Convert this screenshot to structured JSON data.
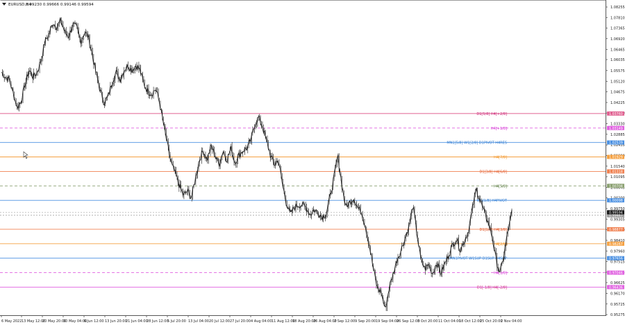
{
  "header": {
    "symbol_label": "EURUSD,H4",
    "ohlc_label": "0.99230 0.99666 0.99146 0.99594",
    "menu_icon": "triangle-down-icon"
  },
  "price_axis": {
    "ticks": [
      "1.08255",
      "1.07810",
      "1.07365",
      "1.06920",
      "1.06465",
      "1.06035",
      "1.05575",
      "1.05120",
      "1.04675",
      "1.04225",
      "1.03780",
      "1.03330",
      "1.02885",
      "1.02435",
      "1.01990",
      "1.01540",
      "1.01095",
      "1.00645",
      "1.00200",
      "0.99750",
      "0.99305",
      "0.98860",
      "0.98410",
      "0.97960",
      "0.97515",
      "0.97065",
      "0.96625",
      "0.96170",
      "0.95725",
      "0.95275"
    ],
    "range": [
      0.9525,
      1.0855
    ]
  },
  "time_axis": {
    "labels": [
      "6 May 2022",
      "13 May 12:00",
      "20 May 20:00",
      "30 May 04:00",
      "6 Jun 12:00",
      "13 Jun 20:00",
      "21 Jun 04:00",
      "28 Jun 12:00",
      "5 Jul 20:00",
      "13 Jul 04:00",
      "20 Jul 12:00",
      "27 Jul 20:00",
      "4 Aug 04:00",
      "11 Aug 12:00",
      "18 Aug 20:00",
      "26 Aug 04:00",
      "2 Sep 12:00",
      "9 Sep 20:00",
      "19 Sep 04:00",
      "26 Sep 12:00",
      "3 Oct 20:00",
      "11 Oct 04:00",
      "18 Oct 12:00",
      "25 Oct 20:00",
      "2 Nov 04:00"
    ]
  },
  "levels": [
    {
      "price": 1.0376,
      "label": "D1[5/8] H4[+2/8]",
      "tag": "1.03760",
      "color": "#e06090",
      "style": "solid",
      "label_color": "#c8166e"
    },
    {
      "price": 1.03149,
      "label": "H4[+1/8]",
      "tag": "1.03149",
      "color": "#e060e0",
      "style": "dash",
      "label_color": "#d020d0"
    },
    {
      "price": 1.02539,
      "label": "MN1[5/8] W1[2/8] D1PIVOT H4RES",
      "tag": "1.02539",
      "color": "#4a90e2",
      "style": "solid",
      "label_color": "#2a78d0"
    },
    {
      "price": 1.01929,
      "label": "H4[7/8]",
      "tag": "1.01929",
      "color": "#f5a040",
      "style": "solid",
      "label_color": "#f08a10"
    },
    {
      "price": 1.01318,
      "label": "D1[3/8] H4[6/8]",
      "tag": "1.01318",
      "color": "#f08050",
      "style": "solid",
      "label_color": "#e05020"
    },
    {
      "price": 1.00708,
      "label": "H4[5/8]",
      "tag": "1.00708",
      "color": "#8aa070",
      "style": "dash",
      "label_color": "#4a7030"
    },
    {
      "price": 1.00098,
      "label": "W1[1/8] H4PIVOT",
      "tag": "1.00098",
      "color": "#4a90e2",
      "style": "solid",
      "label_color": "#2a78d0"
    },
    {
      "price": 0.98877,
      "label": "D1[1/8] H4[3/8]",
      "tag": "0.98877",
      "color": "#f08050",
      "style": "solid",
      "label_color": "#e05020"
    },
    {
      "price": 0.98267,
      "label": "H4[2/8]",
      "tag": "0.98267",
      "color": "#f5a040",
      "style": "solid",
      "label_color": "#f08a10"
    },
    {
      "price": 0.97656,
      "label": "MN1PIVOT W1SUP D1SUP H4SUP",
      "tag": "0.97656",
      "color": "#4a90e2",
      "style": "solid",
      "label_color": "#2a78d0"
    },
    {
      "price": 0.97046,
      "label": "H4[1/8]",
      "tag": "0.97046",
      "color": "#e060e0",
      "style": "dash",
      "label_color": "#d020d0"
    },
    {
      "price": 0.96436,
      "label": "D1[-1/8] H4[-2/8]",
      "tag": "0.96436",
      "color": "#e060e0",
      "style": "solid",
      "label_color": "#c8166e"
    }
  ],
  "current_price": {
    "price": 0.99594,
    "tag": "0.99594"
  },
  "secondary_price": {
    "price": 0.99467,
    "tag": "0.99467"
  },
  "chart_data": {
    "type": "candlestick-line",
    "symbol": "EURUSD",
    "timeframe": "H4",
    "ylim": [
      0.9525,
      1.0855
    ],
    "waypoints": [
      [
        0,
        1.055
      ],
      [
        2,
        1.053
      ],
      [
        4,
        1.052
      ],
      [
        6,
        1.046
      ],
      [
        8,
        1.04
      ],
      [
        10,
        1.043
      ],
      [
        12,
        1.05
      ],
      [
        14,
        1.056
      ],
      [
        16,
        1.053
      ],
      [
        18,
        1.055
      ],
      [
        20,
        1.06
      ],
      [
        22,
        1.068
      ],
      [
        24,
        1.071
      ],
      [
        26,
        1.076
      ],
      [
        28,
        1.074
      ],
      [
        30,
        1.077
      ],
      [
        32,
        1.072
      ],
      [
        34,
        1.07
      ],
      [
        36,
        1.075
      ],
      [
        38,
        1.074
      ],
      [
        40,
        1.068
      ],
      [
        42,
        1.072
      ],
      [
        44,
        1.07
      ],
      [
        46,
        1.062
      ],
      [
        48,
        1.054
      ],
      [
        50,
        1.047
      ],
      [
        52,
        1.042
      ],
      [
        54,
        1.045
      ],
      [
        56,
        1.051
      ],
      [
        58,
        1.055
      ],
      [
        60,
        1.052
      ],
      [
        62,
        1.056
      ],
      [
        64,
        1.058
      ],
      [
        66,
        1.056
      ],
      [
        68,
        1.058
      ],
      [
        70,
        1.056
      ],
      [
        72,
        1.05
      ],
      [
        74,
        1.047
      ],
      [
        76,
        1.046
      ],
      [
        78,
        1.048
      ],
      [
        80,
        1.042
      ],
      [
        82,
        1.033
      ],
      [
        84,
        1.024
      ],
      [
        86,
        1.016
      ],
      [
        88,
        1.012
      ],
      [
        90,
        1.007
      ],
      [
        92,
        1.003
      ],
      [
        94,
        1.005
      ],
      [
        96,
        1.002
      ],
      [
        98,
        1.01
      ],
      [
        100,
        1.018
      ],
      [
        102,
        1.022
      ],
      [
        104,
        1.018
      ],
      [
        106,
        1.024
      ],
      [
        108,
        1.02
      ],
      [
        110,
        1.016
      ],
      [
        112,
        1.022
      ],
      [
        114,
        1.018
      ],
      [
        116,
        1.023
      ],
      [
        118,
        1.017
      ],
      [
        120,
        1.02
      ],
      [
        122,
        1.022
      ],
      [
        124,
        1.023
      ],
      [
        126,
        1.026
      ],
      [
        128,
        1.033
      ],
      [
        130,
        1.036
      ],
      [
        132,
        1.032
      ],
      [
        134,
        1.026
      ],
      [
        136,
        1.02
      ],
      [
        138,
        1.016
      ],
      [
        140,
        1.018
      ],
      [
        142,
        1.008
      ],
      [
        144,
        1.0
      ],
      [
        146,
        0.995
      ],
      [
        148,
        0.998
      ],
      [
        150,
        0.999
      ],
      [
        152,
        0.999
      ],
      [
        154,
        0.998
      ],
      [
        156,
        0.995
      ],
      [
        158,
        0.997
      ],
      [
        160,
        0.996
      ],
      [
        162,
        0.994
      ],
      [
        164,
        0.995
      ],
      [
        166,
        1.002
      ],
      [
        168,
        1.01
      ],
      [
        170,
        1.02
      ],
      [
        172,
        1.008
      ],
      [
        174,
        0.998
      ],
      [
        176,
        1.0
      ],
      [
        178,
        1.002
      ],
      [
        180,
        0.998
      ],
      [
        182,
        0.996
      ],
      [
        184,
        0.99
      ],
      [
        186,
        0.982
      ],
      [
        188,
        0.972
      ],
      [
        190,
        0.964
      ],
      [
        192,
        0.962
      ],
      [
        194,
        0.955
      ],
      [
        196,
        0.964
      ],
      [
        198,
        0.97
      ],
      [
        200,
        0.976
      ],
      [
        202,
        0.98
      ],
      [
        204,
        0.985
      ],
      [
        206,
        0.99
      ],
      [
        208,
        0.999
      ],
      [
        210,
        0.987
      ],
      [
        212,
        0.976
      ],
      [
        214,
        0.972
      ],
      [
        216,
        0.974
      ],
      [
        218,
        0.97
      ],
      [
        220,
        0.975
      ],
      [
        222,
        0.97
      ],
      [
        224,
        0.974
      ],
      [
        226,
        0.978
      ],
      [
        228,
        0.982
      ],
      [
        230,
        0.985
      ],
      [
        232,
        0.98
      ],
      [
        234,
        0.984
      ],
      [
        236,
        0.988
      ],
      [
        238,
        0.997
      ],
      [
        240,
        1.006
      ],
      [
        242,
        1.001
      ],
      [
        244,
        0.996
      ],
      [
        246,
        0.992
      ],
      [
        248,
        0.986
      ],
      [
        250,
        0.976
      ],
      [
        252,
        0.97
      ],
      [
        254,
        0.978
      ],
      [
        256,
        0.988
      ],
      [
        258,
        0.9959
      ]
    ]
  }
}
